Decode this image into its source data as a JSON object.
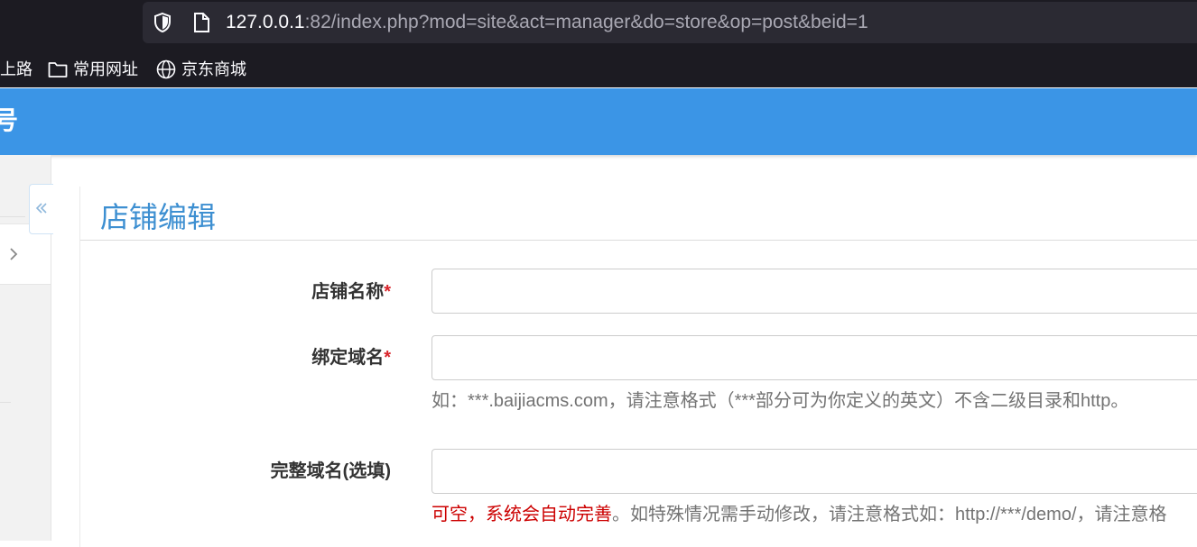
{
  "browser": {
    "url_host": "127.0.0.1",
    "url_rest": ":82/index.php?mod=site&act=manager&do=store&op=post&beid=1",
    "bookmarks": [
      {
        "label": "上路"
      },
      {
        "label": "常用网址",
        "icon": "folder-icon"
      },
      {
        "label": "京东商城",
        "icon": "globe-icon"
      }
    ]
  },
  "header": {
    "logo_fragment": "号"
  },
  "page": {
    "title": "店铺编辑",
    "fields": [
      {
        "label": "店铺名称",
        "required": "*",
        "value": ""
      },
      {
        "label": "绑定域名",
        "required": "*",
        "value": "",
        "help": "如：***.baijiacms.com，请注意格式（***部分可为你定义的英文）不含二级目录和http。"
      },
      {
        "label": "完整域名(选填)",
        "value": "",
        "help_red": "可空，系统会自动完善",
        "help": "。如特殊情况需手动修改，请注意格式如：http://***/demo/，请注意格"
      }
    ]
  },
  "colors": {
    "header_blue": "#3b95e6",
    "title_blue": "#3d8fd1",
    "required_red": "#d9242b"
  }
}
